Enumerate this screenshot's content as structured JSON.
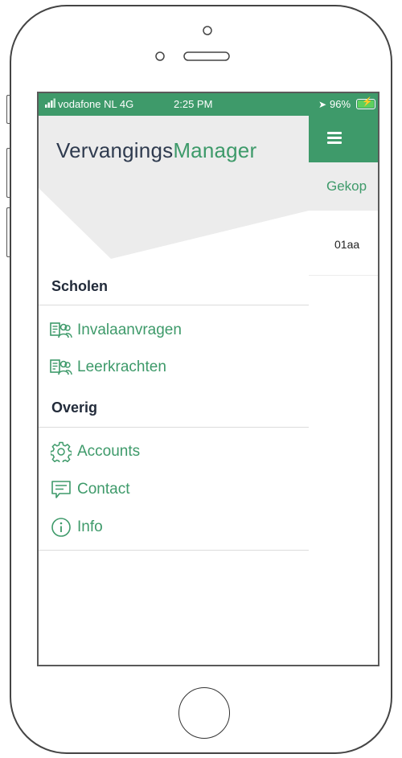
{
  "status_bar": {
    "carrier": "vodafone NL 4G",
    "time": "2:25 PM",
    "battery": "96%"
  },
  "background": {
    "tab_label": "Gekop",
    "row_label": "01aa"
  },
  "drawer": {
    "logo": {
      "part1": "Vervangings",
      "part2": "Manager"
    },
    "sections": [
      {
        "title": "Scholen",
        "items": [
          {
            "label": "Invalaanvragen",
            "icon": "people-list-icon"
          },
          {
            "label": "Leerkrachten",
            "icon": "people-list-icon"
          }
        ]
      },
      {
        "title": "Overig",
        "items": [
          {
            "label": "Accounts",
            "icon": "gear-icon"
          },
          {
            "label": "Contact",
            "icon": "chat-icon"
          },
          {
            "label": "Info",
            "icon": "info-icon"
          }
        ]
      }
    ]
  },
  "colors": {
    "accent": "#3e9a6a",
    "title_dark": "#2f3b4f"
  }
}
